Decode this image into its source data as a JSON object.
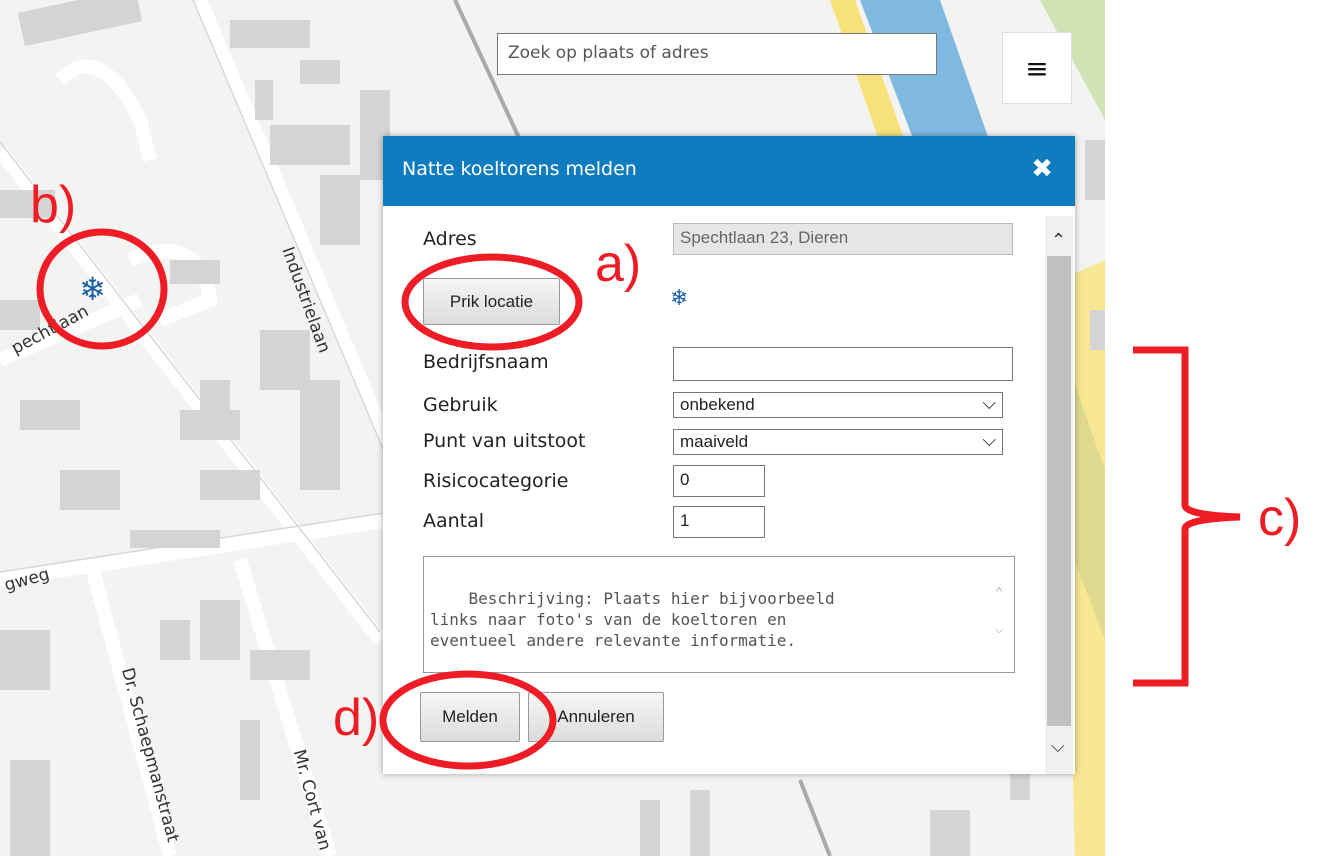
{
  "map": {
    "street_labels": {
      "spechtlaan": "pechtlaan",
      "industrielaan": "Industrielaan",
      "gweg": "gweg",
      "schaepman": "Dr. Schaepmanstraat",
      "cortvan": "Mr. Cort van"
    }
  },
  "search": {
    "placeholder": "Zoek op plaats of adres"
  },
  "menu": {
    "icon": "hamburger-icon",
    "glyph": "≡"
  },
  "dialog": {
    "title": "Natte koeltorens melden",
    "close_glyph": "✖",
    "fields": {
      "adres_label": "Adres",
      "adres_value": "Spechtlaan 23, Dieren",
      "prik_button": "Prik locatie",
      "bedrijfsnaam_label": "Bedrijfsnaam",
      "bedrijfsnaam_value": "",
      "gebruik_label": "Gebruik",
      "gebruik_value": "onbekend",
      "uitstoot_label": "Punt van uitstoot",
      "uitstoot_value": "maaiveld",
      "risico_label": "Risicocategorie",
      "risico_value": "0",
      "aantal_label": "Aantal",
      "aantal_value": "1",
      "beschrijving": "Beschrijving: Plaats hier bijvoorbeeld\nlinks naar foto's van de koeltoren en\neventueel andere relevante informatie."
    },
    "buttons": {
      "melden": "Melden",
      "annuleren": "Annuleren"
    }
  },
  "icons": {
    "snowflake": "❄",
    "chevron_down": "⌵",
    "chevron_up": "⌃"
  },
  "annotations": {
    "a": "a)",
    "b": "b)",
    "c": "c)",
    "d": "d)"
  },
  "colors": {
    "header": "#0e7cbf",
    "annotation": "#ee1c24",
    "canal": "#7fb9e0",
    "road_yellow": "#f7e27a"
  }
}
